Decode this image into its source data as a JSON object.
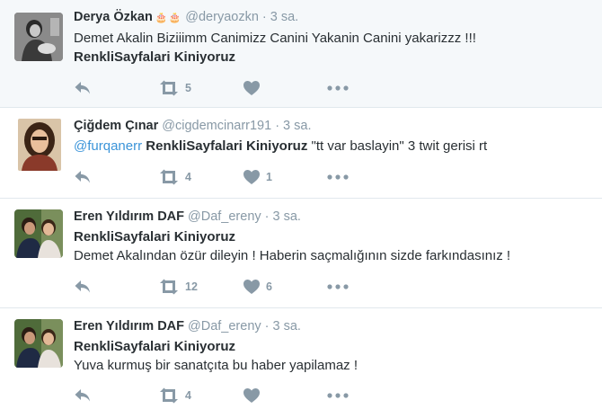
{
  "colors": {
    "accent": "#3b94d9",
    "text": "#292f33",
    "muted": "#8899a6",
    "divider": "#e1e8ed",
    "highlight_bg": "#f5f8fa"
  },
  "icons": {
    "reply": "reply-icon",
    "retweet": "retweet-icon",
    "like": "heart-icon",
    "more": "more-icon"
  },
  "tweets": [
    {
      "name": "Derya Özkan",
      "badges": "🎂🎂",
      "handle": "@deryaozkn",
      "dot": "·",
      "time": "3 sa.",
      "line1": "Demet Akalin Biziiimm Canimizz Canini Yakanin Canini yakarizzz !!!",
      "line2": "RenkliSayfalari Kiniyoruz",
      "retweets": "5",
      "likes": ""
    },
    {
      "name": "Çiğdem Çınar",
      "handle": "@cigdemcinarr191",
      "dot": "·",
      "time": "3 sa.",
      "mention": "@furqanerr",
      "bold": "RenkliSayfalari Kiniyoruz",
      "rest": "\"tt var baslayin\" 3 twit gerisi rt",
      "retweets": "4",
      "likes": "1"
    },
    {
      "name": "Eren Yıldırım DAF",
      "handle": "@Daf_ereny",
      "dot": "·",
      "time": "3 sa.",
      "line1": "RenkliSayfalari Kiniyoruz",
      "line2": "Demet Akalından özür dileyin ! Haberin saçmalığının sizde farkındasınız !",
      "retweets": "12",
      "likes": "6"
    },
    {
      "name": "Eren Yıldırım DAF",
      "handle": "@Daf_ereny",
      "dot": "·",
      "time": "3 sa.",
      "line1": "RenkliSayfalari Kiniyoruz",
      "line2": "Yuva kurmuş bir sanatçıta bu haber yapilamaz !",
      "retweets": "4",
      "likes": ""
    }
  ]
}
